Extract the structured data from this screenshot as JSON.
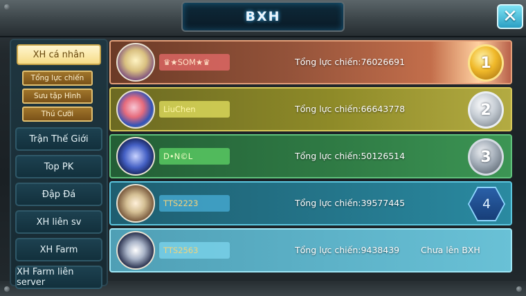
{
  "header": {
    "title": "BXH",
    "close_icon": "close-x-icon"
  },
  "sidebar": {
    "active_tab": "XH cá nhân",
    "sub_tabs": [
      "Tổng lực chiến",
      "Sưu tập Hình",
      "Thú Cưỡi"
    ],
    "tabs": [
      "Trận Thế Giới",
      "Top PK",
      "Đập Đá",
      "XH liên sv",
      "XH Farm",
      "XH Farm liên server"
    ]
  },
  "rankings": [
    {
      "rank": "1",
      "name": "♛★SOM★♛",
      "power_label": "Tổng lực chiến:76026691",
      "rank_icon": "gold-medal-icon"
    },
    {
      "rank": "2",
      "name": "LiuChen",
      "power_label": "Tổng lực chiến:66643778",
      "rank_icon": "silver-medal-icon"
    },
    {
      "rank": "3",
      "name": "D•N©L",
      "power_label": "Tổng lực chiến:50126514",
      "rank_icon": "bronze-medal-icon"
    },
    {
      "rank": "4",
      "name": "TTS2223",
      "power_label": "Tổng lực chiến:39577445",
      "rank_icon": "hexagon-badge-icon"
    },
    {
      "rank": "",
      "name": "TTS2563",
      "power_label": "Tổng lực chiến:9438439",
      "status": "Chưa lên BXH"
    }
  ],
  "colors": {
    "gold": "#f0b92a",
    "title_glow": "#3cb9ff",
    "close_button": "#2a9fc3"
  }
}
